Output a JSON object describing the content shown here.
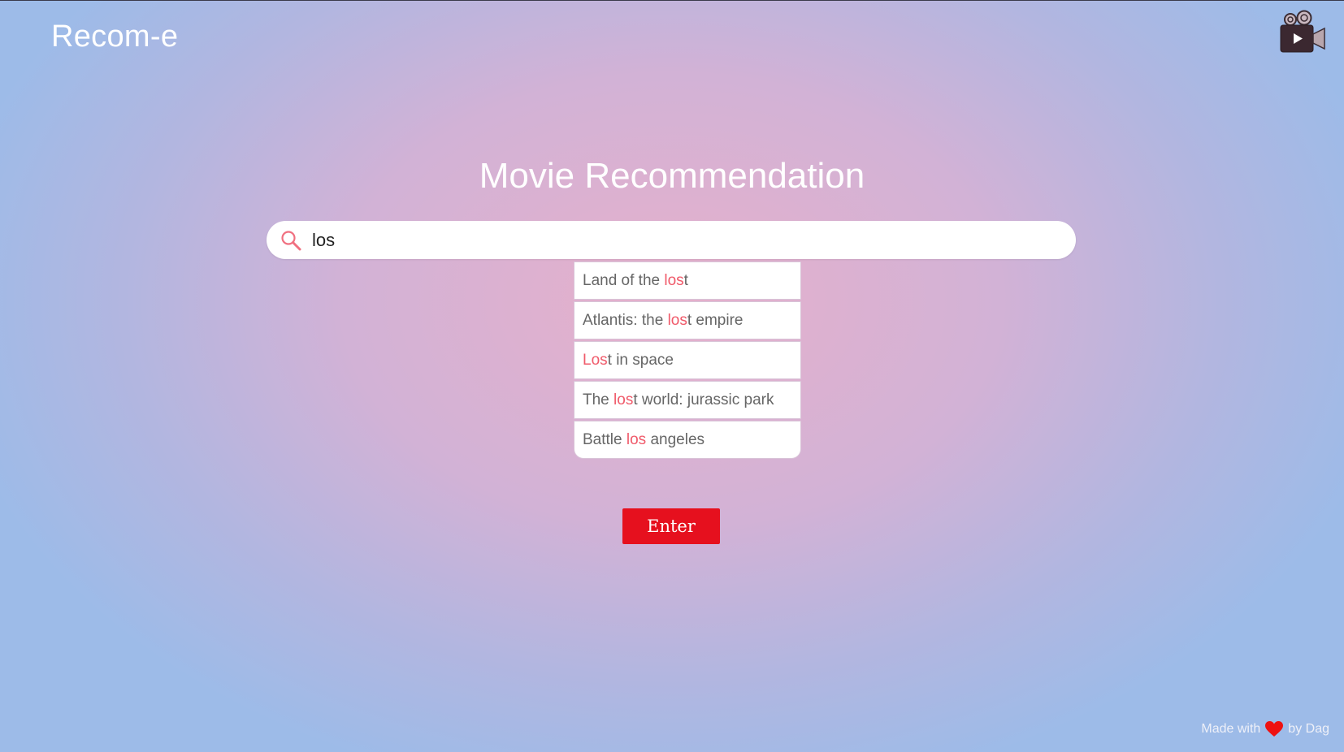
{
  "header": {
    "brand": "Recom-e",
    "logo_icon": "movie-camera-icon"
  },
  "main": {
    "title": "Movie Recommendation",
    "search": {
      "value": "los",
      "icon": "search-icon"
    },
    "suggestions": [
      {
        "before": "Land of the ",
        "match": "los",
        "after": "t"
      },
      {
        "before": "Atlantis: the ",
        "match": "los",
        "after": "t empire"
      },
      {
        "before": "",
        "match": "Los",
        "after": "t in space"
      },
      {
        "before": "The ",
        "match": "los",
        "after": "t world: jurassic park"
      },
      {
        "before": "Battle ",
        "match": "los",
        "after": " angeles"
      }
    ],
    "enter_label": "Enter"
  },
  "footer": {
    "prefix": "Made with",
    "suffix": "by Dag",
    "icon": "heart-icon"
  },
  "colors": {
    "accent": "#e6101e",
    "highlight": "#f05a6a",
    "heart": "#ee1111"
  }
}
